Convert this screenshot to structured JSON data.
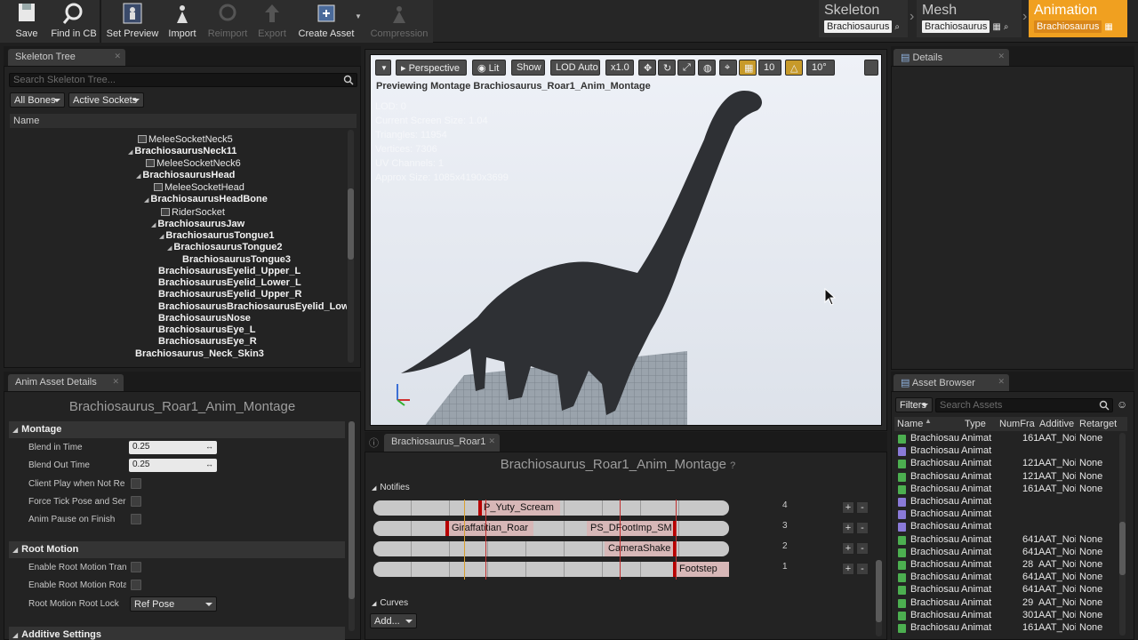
{
  "toolbar": {
    "buttons": [
      {
        "label": "Save",
        "enabled": true,
        "icon": "save-icon"
      },
      {
        "label": "Find in CB",
        "enabled": true,
        "icon": "find-in-cb-icon"
      },
      {
        "label": "Set Preview",
        "enabled": true,
        "icon": "set-preview-icon"
      },
      {
        "label": "Import",
        "enabled": true,
        "icon": "import-icon"
      },
      {
        "label": "Reimport",
        "enabled": false,
        "icon": "reimport-icon"
      },
      {
        "label": "Export",
        "enabled": false,
        "icon": "export-icon"
      },
      {
        "label": "Create Asset",
        "enabled": true,
        "icon": "create-asset-icon"
      },
      {
        "label": "Compression",
        "enabled": false,
        "icon": "compression-icon"
      }
    ],
    "modes": [
      {
        "title": "Skeleton",
        "asset": "Brachiosaurus"
      },
      {
        "title": "Mesh",
        "asset": "Brachiosaurus"
      },
      {
        "title": "Animation",
        "asset": "Brachiosaurus",
        "active": true
      }
    ]
  },
  "skeleton_tree": {
    "tab": "Skeleton Tree",
    "search_placeholder": "Search Skeleton Tree...",
    "filter_bones": "All Bones",
    "filter_sockets": "Active Sockets",
    "column_header": "Name",
    "rows": [
      {
        "label": "MeleeSocketNeck5",
        "socket": true
      },
      {
        "label": "BrachiosaurusNeck11",
        "socket": false
      },
      {
        "label": "MeleeSocketNeck6",
        "socket": true
      },
      {
        "label": "BrachiosaurusHead",
        "socket": false
      },
      {
        "label": "MeleeSocketHead",
        "socket": true
      },
      {
        "label": "BrachiosaurusHeadBone",
        "socket": false
      },
      {
        "label": "RiderSocket",
        "socket": true
      },
      {
        "label": "BrachiosaurusJaw",
        "socket": false
      },
      {
        "label": "BrachiosaurusTongue1",
        "socket": false
      },
      {
        "label": "BrachiosaurusTongue2",
        "socket": false
      },
      {
        "label": "BrachiosaurusTongue3",
        "socket": false
      },
      {
        "label": "BrachiosaurusEyelid_Upper_L",
        "socket": false
      },
      {
        "label": "BrachiosaurusEyelid_Lower_L",
        "socket": false
      },
      {
        "label": "BrachiosaurusEyelid_Upper_R",
        "socket": false
      },
      {
        "label": "BrachiosaurusBrachiosaurusEyelid_Lowe",
        "socket": false
      },
      {
        "label": "BrachiosaurusNose",
        "socket": false
      },
      {
        "label": "BrachiosaurusEye_L",
        "socket": false
      },
      {
        "label": "BrachiosaurusEye_R",
        "socket": false
      },
      {
        "label": "Brachiosaurus_Neck_Skin3",
        "socket": false
      }
    ]
  },
  "asset_details": {
    "tab": "Anim Asset Details",
    "title": "Brachiosaurus_Roar1_Anim_Montage",
    "montage_category": "Montage",
    "blend_in_label": "Blend in Time",
    "blend_in_value": "0.25",
    "blend_out_label": "Blend Out Time",
    "blend_out_value": "0.25",
    "client_play_label": "Client Play when Not Re",
    "force_tick_label": "Force Tick Pose and Ser",
    "anim_pause_label": "Anim Pause on Finish",
    "root_motion_category": "Root Motion",
    "enable_root_tran_label": "Enable Root Motion Tran",
    "enable_root_rota_label": "Enable Root Motion Rota",
    "root_lock_label": "Root Motion Root Lock",
    "root_lock_value": "Ref Pose",
    "additive_category": "Additive Settings"
  },
  "viewport": {
    "buttons": [
      "Perspective",
      "Lit",
      "Show",
      "LOD Auto",
      "x1.0"
    ],
    "grid_value": "10",
    "rotation_value": "10°",
    "preview_text": "Previewing Montage Brachiosaurus_Roar1_Anim_Montage",
    "stats": [
      "LOD: 0",
      "Current Screen Size: 1.04",
      "Triangles: 11954",
      "Vertices: 7306",
      "UV Channels: 1",
      "Approx Size: 1085x4190x3699"
    ]
  },
  "montage": {
    "tab": "Brachiosaurus_Roar1",
    "title": "Brachiosaurus_Roar1_Anim_Montage",
    "notifies_label": "Notifies",
    "tracks": [
      {
        "number": "4",
        "notifies": [
          "P_Yuty_Scream"
        ]
      },
      {
        "number": "3",
        "notifies": [
          "Giraffatitian_Roar",
          "PS_DFootImp_SM"
        ]
      },
      {
        "number": "2",
        "notifies": [
          "CameraShake"
        ]
      },
      {
        "number": "1",
        "notifies": [
          "Footstep"
        ]
      }
    ],
    "curves_label": "Curves",
    "add_label": "Add..."
  },
  "details": {
    "tab": "Details"
  },
  "asset_browser": {
    "tab": "Asset Browser",
    "filters_label": "Filters",
    "search_placeholder": "Search Assets",
    "columns": [
      "Name",
      "Type",
      "NumFra",
      "Additive",
      "Retarget"
    ],
    "rows": [
      {
        "name": "Brachiosau",
        "type": "Animat",
        "frames": "161",
        "additive": "AAT_Noi",
        "retarget": "None",
        "kind": "sequence"
      },
      {
        "name": "Brachiosau",
        "type": "Animat",
        "frames": "",
        "additive": "",
        "retarget": "",
        "kind": "montage"
      },
      {
        "name": "Brachiosau",
        "type": "Animat",
        "frames": "121",
        "additive": "AAT_Noi",
        "retarget": "None",
        "kind": "sequence"
      },
      {
        "name": "Brachiosau",
        "type": "Animat",
        "frames": "121",
        "additive": "AAT_Noi",
        "retarget": "None",
        "kind": "sequence"
      },
      {
        "name": "Brachiosau",
        "type": "Animat",
        "frames": "161",
        "additive": "AAT_Noi",
        "retarget": "None",
        "kind": "sequence"
      },
      {
        "name": "Brachiosau",
        "type": "Animat",
        "frames": "",
        "additive": "",
        "retarget": "",
        "kind": "montage"
      },
      {
        "name": "Brachiosau",
        "type": "Animat",
        "frames": "",
        "additive": "",
        "retarget": "",
        "kind": "montage"
      },
      {
        "name": "Brachiosau",
        "type": "Animat",
        "frames": "",
        "additive": "",
        "retarget": "",
        "kind": "montage"
      },
      {
        "name": "Brachiosau",
        "type": "Animat",
        "frames": "641",
        "additive": "AAT_Noi",
        "retarget": "None",
        "kind": "sequence"
      },
      {
        "name": "Brachiosau",
        "type": "Animat",
        "frames": "641",
        "additive": "AAT_Noi",
        "retarget": "None",
        "kind": "sequence"
      },
      {
        "name": "Brachiosau",
        "type": "Animat",
        "frames": "28",
        "additive": "AAT_Noi",
        "retarget": "None",
        "kind": "sequence"
      },
      {
        "name": "Brachiosau",
        "type": "Animat",
        "frames": "641",
        "additive": "AAT_Noi",
        "retarget": "None",
        "kind": "sequence"
      },
      {
        "name": "Brachiosau",
        "type": "Animat",
        "frames": "641",
        "additive": "AAT_Noi",
        "retarget": "None",
        "kind": "sequence"
      },
      {
        "name": "Brachiosau",
        "type": "Animat",
        "frames": "29",
        "additive": "AAT_Noi",
        "retarget": "None",
        "kind": "sequence"
      },
      {
        "name": "Brachiosau",
        "type": "Animat",
        "frames": "301",
        "additive": "AAT_Noi",
        "retarget": "None",
        "kind": "sequence"
      },
      {
        "name": "Brachiosau",
        "type": "Animat",
        "frames": "161",
        "additive": "AAT_Noi",
        "retarget": "None",
        "kind": "sequence"
      }
    ]
  },
  "colors": {
    "accent": "#f0a020",
    "notify_marker": "#b80000",
    "sequence_icon": "#4caf50",
    "montage_icon": "#8a7ad8"
  }
}
